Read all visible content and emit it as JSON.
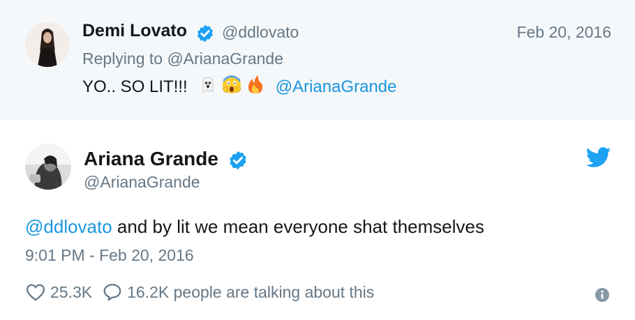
{
  "reply": {
    "name": "Demi Lovato",
    "handle": "@ddlovato",
    "date": "Feb 20, 2016",
    "replying_to": "Replying to @ArianaGrande",
    "text": "YO.. SO LIT!!!",
    "emojis": [
      "ghost-emoji",
      "scream-emoji",
      "fire-emoji"
    ],
    "mention": "@ArianaGrande"
  },
  "tweet": {
    "name": "Ariana Grande",
    "handle": "@ArianaGrande",
    "mention": "@ddlovato",
    "text": " and by lit we mean everyone shat themselves",
    "timestamp": "9:01 PM - Feb 20, 2016",
    "likes": "25.3K",
    "talking": "16.2K people are talking about this"
  },
  "colors": {
    "link": "#1b95e0",
    "verified": "#1da1f2",
    "muted": "#657786",
    "reply_bg": "#f5f8fa"
  },
  "icons": [
    "verified-badge-icon",
    "twitter-bird-icon",
    "heart-icon",
    "comment-bubble-icon",
    "info-icon"
  ]
}
